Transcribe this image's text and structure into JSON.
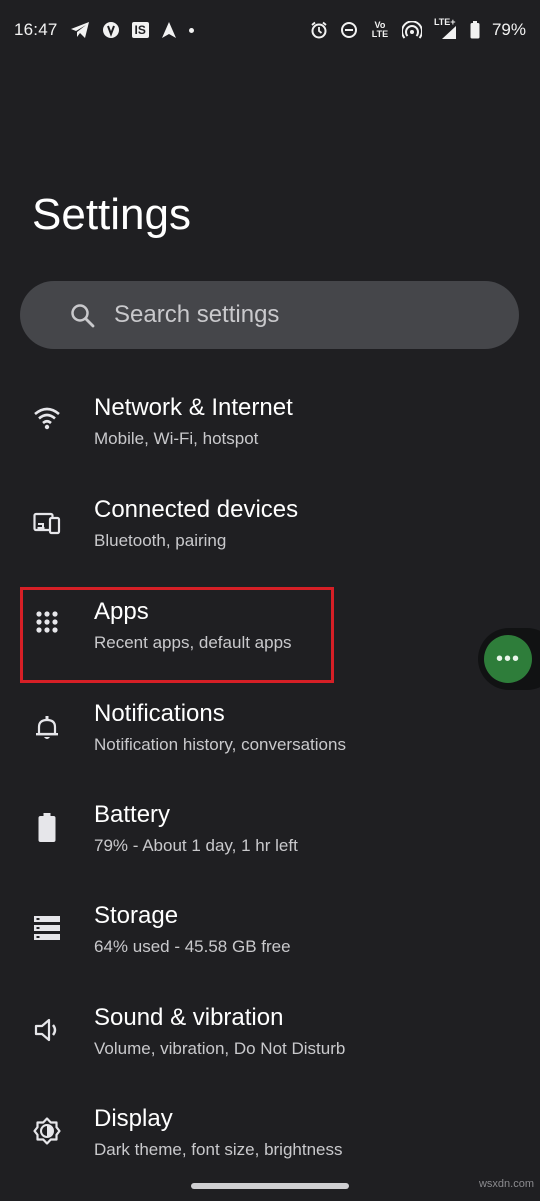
{
  "status_bar": {
    "time": "16:47",
    "battery": "79%",
    "volte_label": "Vo LTE",
    "lte_label": "LTE+",
    "notif_box_label": "IS"
  },
  "page": {
    "title": "Settings"
  },
  "search": {
    "placeholder": "Search settings"
  },
  "settings_items": [
    {
      "icon": "wifi-icon",
      "label": "Network & Internet",
      "subtitle": "Mobile, Wi-Fi, hotspot"
    },
    {
      "icon": "connected-devices-icon",
      "label": "Connected devices",
      "subtitle": "Bluetooth, pairing"
    },
    {
      "icon": "apps-grid-icon",
      "label": "Apps",
      "subtitle": "Recent apps, default apps"
    },
    {
      "icon": "bell-icon",
      "label": "Notifications",
      "subtitle": "Notification history, conversations"
    },
    {
      "icon": "battery-icon",
      "label": "Battery",
      "subtitle": "79% - About 1 day, 1 hr left"
    },
    {
      "icon": "storage-icon",
      "label": "Storage",
      "subtitle": "64% used - 45.58 GB free"
    },
    {
      "icon": "speaker-icon",
      "label": "Sound & vibration",
      "subtitle": "Volume, vibration, Do Not Disturb"
    },
    {
      "icon": "display-brightness-icon",
      "label": "Display",
      "subtitle": "Dark theme, font size, brightness"
    }
  ],
  "floating_button": {
    "label": "•••"
  },
  "watermark": "wsxdn.com",
  "colors": {
    "background": "#1f1f22",
    "search_bg": "#45464a",
    "highlight": "#d61f26",
    "fab": "#2e7d3a"
  }
}
